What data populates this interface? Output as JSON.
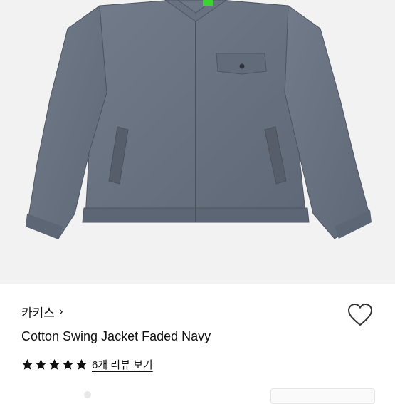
{
  "product": {
    "brand": "카키스",
    "brand_chevron": "›",
    "name": "Cotton Swing Jacket Faded Navy",
    "rating": {
      "stars": 5,
      "max": 5
    },
    "reviews_link": "6개 리뷰 보기",
    "heart_icon": "heart-outline-icon"
  },
  "colors": {
    "jacket": "#6b7583",
    "jacket_shadow": "#586170",
    "background": "#f2f2f2",
    "tag": "#39d42f"
  }
}
